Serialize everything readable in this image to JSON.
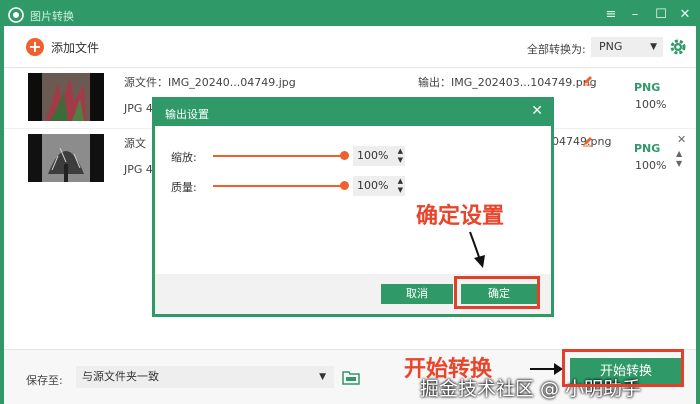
{
  "window": {
    "title": "图片转换",
    "colors": {
      "accent": "#2f9a67",
      "orange": "#f0602e",
      "annotation": "#e2402b"
    }
  },
  "toolbar": {
    "add_label": "添加文件",
    "convert_all_label": "全部转换为:",
    "format_value": "PNG"
  },
  "files": [
    {
      "source": "源文件：IMG_20240...04749.jpg",
      "meta": "JPG  4",
      "output": "输出：IMG_202403...104749.png",
      "format": "PNG",
      "quality": "100%"
    },
    {
      "source": "源文",
      "meta": "JPG  4",
      "output": "04749.png",
      "format": "PNG",
      "quality": "100%"
    }
  ],
  "dialog": {
    "title": "输出设置",
    "zoom_label": "缩放:",
    "zoom_value": "100%",
    "zoom_level": 100,
    "quality_label": "质量:",
    "quality_value": "100%",
    "quality_level": 100,
    "cancel_label": "取消",
    "ok_label": "确定"
  },
  "annotations": {
    "confirm": "确定设置",
    "start": "开始转换"
  },
  "bottom": {
    "save_label": "保存至:",
    "save_value": "与源文件夹一致",
    "start_label": "开始转换"
  },
  "watermark": "掘金技术社区 @ 小明助手"
}
